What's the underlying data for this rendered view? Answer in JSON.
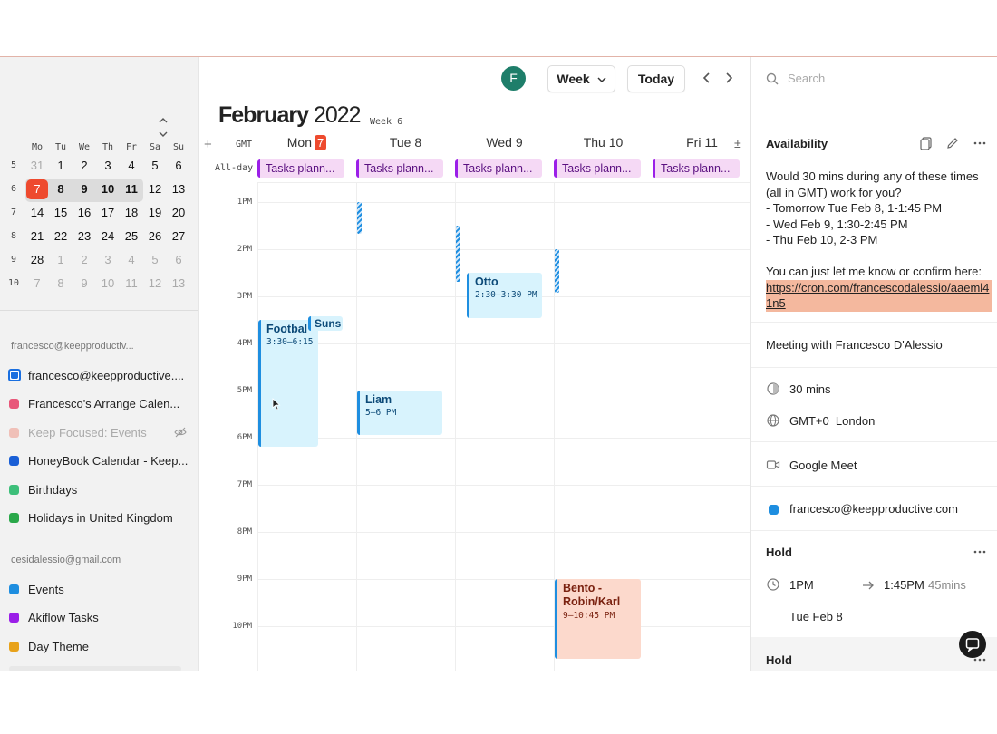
{
  "sidebar": {
    "nav_up": "⌃",
    "nav_down": "⌄",
    "weekday_headers": [
      "Mo",
      "Tu",
      "We",
      "Th",
      "Fr",
      "Sa",
      "Su"
    ],
    "weeks": [
      {
        "num": "5",
        "days": [
          "31",
          "1",
          "2",
          "3",
          "4",
          "5",
          "6"
        ]
      },
      {
        "num": "6",
        "days": [
          "7",
          "8",
          "9",
          "10",
          "11",
          "12",
          "13"
        ]
      },
      {
        "num": "7",
        "days": [
          "14",
          "15",
          "16",
          "17",
          "18",
          "19",
          "20"
        ]
      },
      {
        "num": "8",
        "days": [
          "21",
          "22",
          "23",
          "24",
          "25",
          "26",
          "27"
        ]
      },
      {
        "num": "9",
        "days": [
          "28",
          "1",
          "2",
          "3",
          "4",
          "5",
          "6"
        ]
      },
      {
        "num": "10",
        "days": [
          "7",
          "8",
          "9",
          "10",
          "11",
          "12",
          "13"
        ]
      }
    ],
    "account1": "francesco@keepproductiv...",
    "account1_calendars": [
      {
        "label": "francesco@keepproductive....",
        "color": "#1a6fe0"
      },
      {
        "label": "Francesco's Arrange Calen...",
        "color": "#e8577a"
      },
      {
        "label": "Keep Focused: Events",
        "color": "#f0c0b8"
      },
      {
        "label": "HoneyBook Calendar - Keep...",
        "color": "#1a5fd6"
      },
      {
        "label": "Birthdays",
        "color": "#3dbf7a"
      },
      {
        "label": "Holidays in United Kingdom",
        "color": "#2aa84a"
      }
    ],
    "account2": "cesidalessio@gmail.com",
    "account2_calendars": [
      {
        "label": "Events",
        "color": "#1e8ee0"
      },
      {
        "label": "Akiflow Tasks",
        "color": "#9b1fe8"
      },
      {
        "label": "Day Theme",
        "color": "#e8a21a"
      }
    ]
  },
  "header": {
    "avatar_letter": "F",
    "view_label": "Week",
    "today_label": "Today",
    "month": "February",
    "year": "2022",
    "week_label": "Week 6",
    "add": "+",
    "gmt": "GMT",
    "allday": "All-day",
    "days": [
      {
        "name": "Mon",
        "num": "7",
        "today": true
      },
      {
        "name": "Tue 8"
      },
      {
        "name": "Wed 9"
      },
      {
        "name": "Thu 10"
      },
      {
        "name": "Fri 11"
      }
    ],
    "expand": "±"
  },
  "tasks": [
    "Tasks plann...",
    "Tasks plann...",
    "Tasks plann...",
    "Tasks plann...",
    "Tasks plann..."
  ],
  "hours": [
    "1PM",
    "2PM",
    "3PM",
    "4PM",
    "5PM",
    "6PM",
    "7PM",
    "8PM",
    "9PM",
    "10PM"
  ],
  "events": {
    "football": {
      "title": "Footbal",
      "time": "3:30–6:15"
    },
    "suns": {
      "title": "Suns"
    },
    "liam": {
      "title": "Liam",
      "time": "5–6 PM"
    },
    "otto": {
      "title": "Otto",
      "time": "2:30–3:30 PM"
    },
    "bento": {
      "title": "Bento -\nRobin/Karl",
      "time": "9–10:45 PM"
    }
  },
  "detail": {
    "search_placeholder": "Search",
    "availability_title": "Availability",
    "message_lines": [
      "Would 30 mins during any of these times (all in GMT) work for you?",
      "- Tomorrow Tue Feb 8, 1-1:45 PM",
      "- Wed Feb 9, 1:30-2:45 PM",
      "- Thu Feb 10, 2-3 PM",
      "",
      "You can just let me know or confirm here:"
    ],
    "link": "https://cron.com/francescodalessio/aaeml41n5",
    "meeting_title": "Meeting with Francesco D'Alessio",
    "duration": "30 mins",
    "timezone": "GMT+0  London",
    "conferencing": "Google Meet",
    "calendar_account": "francesco@keepproductive.com",
    "calendar_color": "#1e8ee0",
    "hold1_title": "Hold",
    "hold1_start": "1PM",
    "hold1_end": "1:45PM",
    "hold1_duration": "45mins",
    "hold1_date": "Tue Feb 8",
    "hold2_title": "Hold"
  }
}
